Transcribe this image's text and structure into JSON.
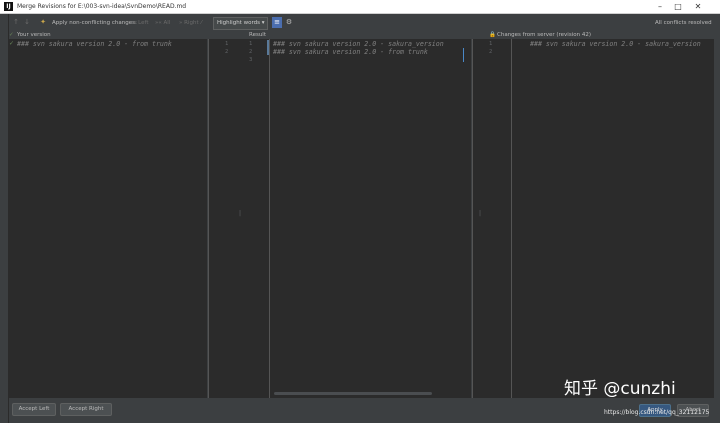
{
  "window": {
    "title": "Merge Revisions for E:\\003-svn-idea\\SvnDemo\\READ.md",
    "app_icon": "intellij-icon"
  },
  "toolbar": {
    "apply_non_conflicting": "Apply non-conflicting changes:",
    "left": "Left",
    "all": "All",
    "right": "Right",
    "highlight_mode": "Highlight words",
    "status": "All conflicts resolved"
  },
  "panes": {
    "left_title": "Your version",
    "center_title": "Result",
    "right_title": "Changes from server (revision 42)"
  },
  "left_editor": {
    "lines": [
      "### svn sakura version 2.0 - from trunk"
    ]
  },
  "center_editor": {
    "line_numbers_left": [
      "1",
      "2"
    ],
    "line_numbers_right": [
      "1",
      "2",
      "3"
    ],
    "lines": [
      "### svn sakura version 2.0 - sakura_version",
      "### svn sakura version 2.0 - from trunk"
    ]
  },
  "right_editor": {
    "line_numbers": [
      "1",
      "2"
    ],
    "lines": [
      "### svn sakura version 2.0 - sakura_version"
    ]
  },
  "buttons": {
    "accept_left": "Accept Left",
    "accept_right": "Accept Right",
    "apply": "Apply",
    "abort": "Abort"
  },
  "watermark": {
    "text": "知乎 @cunzhi",
    "url": "https://blog.csdn.net/qq_32112175"
  },
  "colors": {
    "editor_bg": "#2b2b2b",
    "chrome_bg": "#3c3f41",
    "code_text": "#808080",
    "accent": "#365880"
  }
}
